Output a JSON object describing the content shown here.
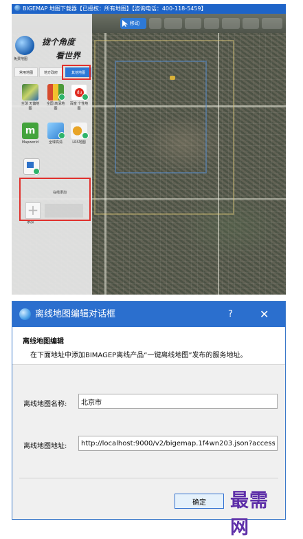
{
  "app": {
    "title": "BIGEMAP 地图下载器【已授权：所有地图】【咨询电话：400-118-5459】",
    "toolbar_active_label": "移动",
    "sidebar_tabs": [
      "常用地图",
      "地方政府",
      "其他地图"
    ],
    "selected_tab_index": 2,
    "slogan_line1": "拢个角度",
    "slogan_line2": "看世界",
    "brand_caption": "免费地图",
    "map_sources": [
      {
        "label": "全球\n无偏地图",
        "icon": "globe-satellite-icon",
        "color": "#3b7d3a"
      },
      {
        "label": "全国\n高清地图",
        "icon": "colorful-pin-icon",
        "color": "#d64a2d"
      },
      {
        "label": "百度\n个性地图",
        "icon": "baidu-icon",
        "color": "#e02b20"
      },
      {
        "label": "Mapworld",
        "icon": "mapworld-icon",
        "color": "#43a33c"
      },
      {
        "label": "全球高清",
        "icon": "globe-tile-icon",
        "color": "#2f7fd1"
      },
      {
        "label": "LRS地图",
        "icon": "pin-cluster-icon",
        "color": "#e8a426"
      },
      {
        "label": "",
        "icon": "offline-map-icon",
        "color": "#2e72c9"
      }
    ],
    "section_title": "在线添加",
    "add_label": "添加"
  },
  "dialog": {
    "title": "离线地图编辑对话框",
    "help_icon": "?",
    "close_icon": "✕",
    "heading": "离线地图编辑",
    "description": "在下面地址中添加BIMAGEP离线产品“一键离线地图”发布的服务地址。",
    "name_label": "离线地图名称:",
    "name_value": "北京市",
    "url_label": "离线地图地址:",
    "url_value": "http://localhost:9000/v2/bigemap.1f4wn203.json?access",
    "ok_label": "确定"
  },
  "watermark": "最需网",
  "colors": {
    "title_blue": "#2b6fce",
    "highlight_red": "#e0302c",
    "watermark_purple": "#5d2ea8"
  }
}
